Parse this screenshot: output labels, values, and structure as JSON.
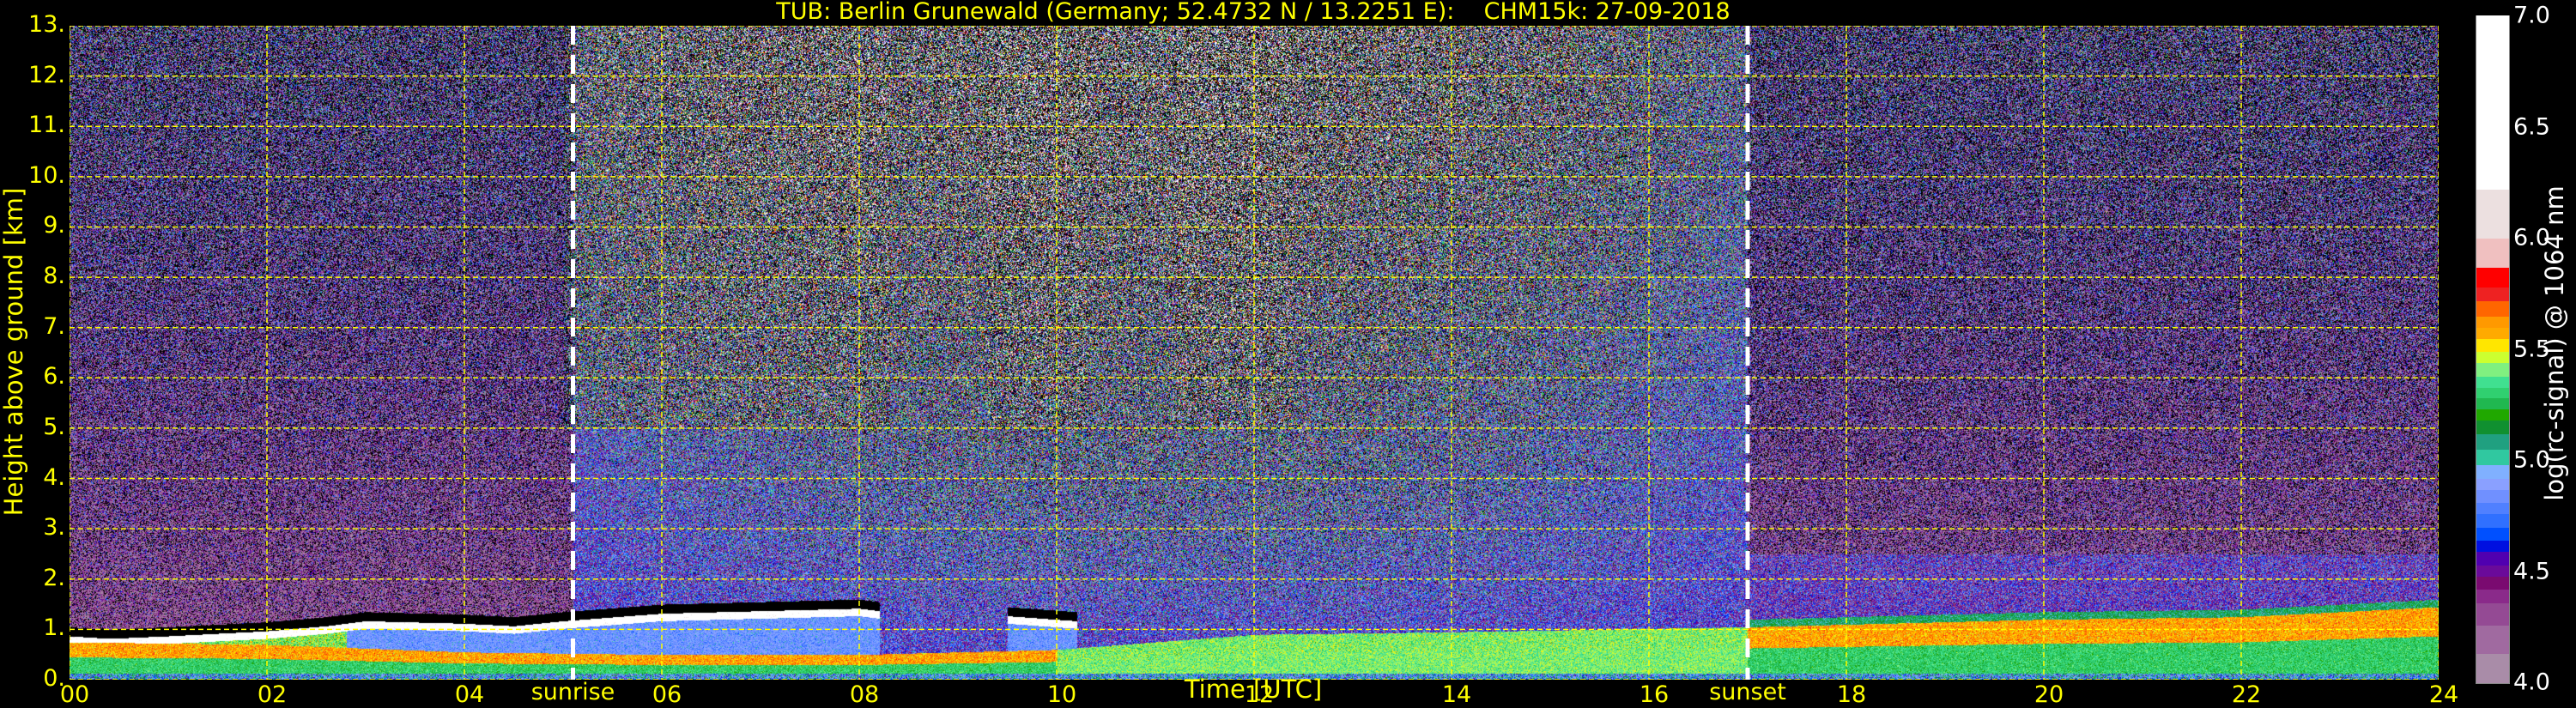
{
  "chart_data": {
    "type": "heatmap",
    "title": "TUB: Berlin Grunewald (Germany; 52.4732 N / 13.2251 E):    CHM15k: 27-09-2018",
    "xlabel": "Time [UTC]",
    "ylabel": "Height above ground [km]",
    "xlim": [
      0,
      24
    ],
    "ylim": [
      0,
      13
    ],
    "x_ticks": [
      "00",
      "02",
      "04",
      "06",
      "08",
      "10",
      "12",
      "14",
      "16",
      "18",
      "20",
      "22",
      "24"
    ],
    "y_ticks": [
      "0.",
      "1.",
      "2.",
      "3.",
      "4.",
      "5.",
      "6.",
      "7.",
      "8.",
      "9.",
      "10.",
      "11.",
      "12.",
      "13."
    ],
    "grid": true,
    "grid_color": "#ffff00",
    "events": [
      {
        "label": "sunrise",
        "hour": 5.1
      },
      {
        "label": "sunset",
        "hour": 17.0
      }
    ],
    "colorbar": {
      "label": "log(rc-signal) @ 1064 nm",
      "range": [
        4.0,
        7.0
      ],
      "ticks": [
        "4.0",
        "4.5",
        "5.0",
        "5.5",
        "6.0",
        "6.5",
        "7.0"
      ],
      "colors": [
        "#a98ca8",
        "#a06aa0",
        "#944a94",
        "#8a2a8a",
        "#7a0a70",
        "#6a0a9a",
        "#5000b0",
        "#0010e0",
        "#0050ff",
        "#3070ff",
        "#5080ff",
        "#7090ff",
        "#8aa0ff",
        "#80b0ff",
        "#30c8a0",
        "#20a080",
        "#109030",
        "#20a800",
        "#20b850",
        "#30d070",
        "#40e090",
        "#80f080",
        "#ccff30",
        "#ffe600",
        "#ffaa00",
        "#ff9900",
        "#ff6600",
        "#ee2222",
        "#ff0000",
        "#f0c0c0",
        "#ece0e0",
        "#ffffff"
      ],
      "bounds": [
        4.0,
        4.13,
        4.26,
        4.36,
        4.42,
        4.48,
        4.53,
        4.59,
        4.64,
        4.7,
        4.76,
        4.81,
        4.87,
        4.92,
        4.98,
        5.05,
        5.12,
        5.18,
        5.23,
        5.28,
        5.33,
        5.38,
        5.44,
        5.49,
        5.55,
        5.6,
        5.65,
        5.72,
        5.78,
        5.87,
        6.0,
        6.22,
        7.0
      ]
    },
    "cloud_layer_km": {
      "hours": [
        0,
        0.4,
        1,
        2,
        2.6,
        3,
        4,
        4.5,
        5,
        6,
        7,
        8,
        8.2,
        8.3,
        9.5,
        10.2,
        10.3
      ],
      "values": [
        0.8,
        0.75,
        0.8,
        0.9,
        1.0,
        1.1,
        1.05,
        1.0,
        1.1,
        1.25,
        1.3,
        1.35,
        1.3,
        null,
        1.2,
        1.1,
        null
      ]
    },
    "mixed_layer_top_km": {
      "hours": [
        0,
        2,
        4,
        6,
        8,
        10,
        12,
        14,
        17,
        18,
        20,
        22,
        24
      ],
      "values": [
        0.75,
        0.7,
        0.55,
        0.5,
        0.5,
        0.6,
        0.9,
        0.95,
        1.05,
        1.1,
        1.2,
        1.25,
        1.45
      ]
    },
    "residual_layer_top_km": {
      "hours": [
        0,
        3,
        4,
        5,
        6,
        8,
        9,
        17,
        24
      ],
      "values": [
        0,
        0.3,
        1.0,
        1.1,
        1.2,
        1.3,
        0,
        0,
        0
      ]
    }
  }
}
